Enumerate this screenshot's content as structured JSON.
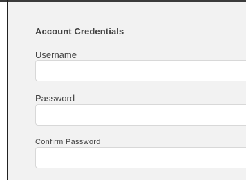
{
  "form": {
    "section_title": "Account Credentials",
    "fields": [
      {
        "label": "Username",
        "value": "",
        "placeholder": ""
      },
      {
        "label": "Password",
        "value": "",
        "placeholder": ""
      },
      {
        "label": "Confirm Password",
        "value": "",
        "placeholder": ""
      }
    ]
  }
}
